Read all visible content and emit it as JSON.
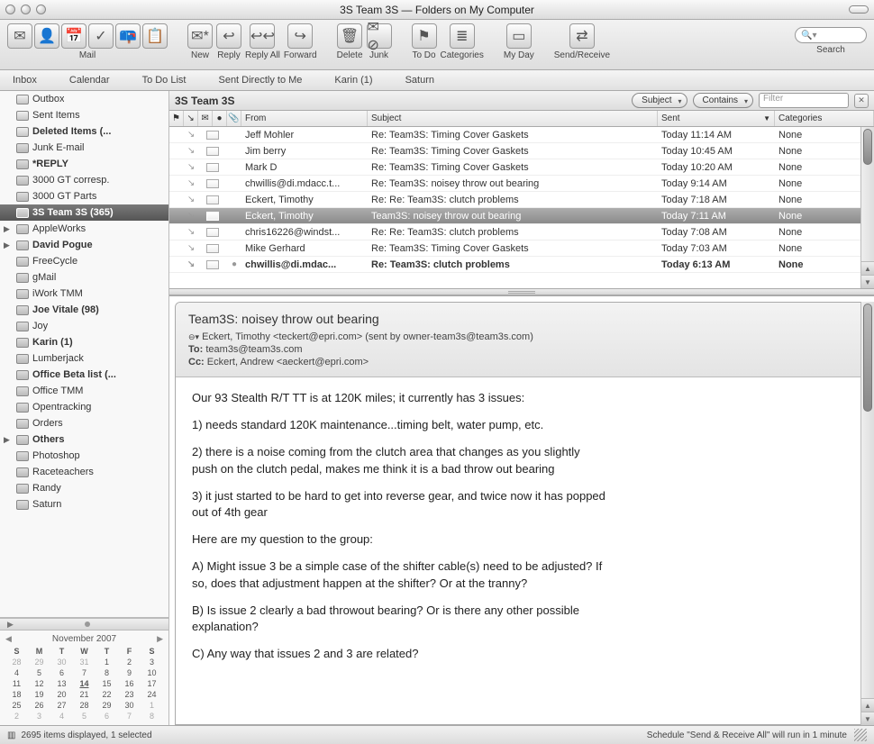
{
  "window": {
    "title": "3S Team 3S — Folders on My Computer"
  },
  "toolbar": {
    "groups": [
      {
        "label": "Mail",
        "icons": [
          "✉",
          "👤",
          "📅",
          "✓",
          "📪",
          "📋"
        ]
      },
      {
        "label": "New",
        "icons": [
          "✉*"
        ]
      },
      {
        "label": "Reply",
        "icons": [
          "↩"
        ]
      },
      {
        "label": "Reply All",
        "icons": [
          "↩↩"
        ]
      },
      {
        "label": "Forward",
        "icons": [
          "↪"
        ]
      },
      {
        "label": "Delete",
        "icons": [
          "🗑"
        ]
      },
      {
        "label": "Junk",
        "icons": [
          "✉⊘"
        ]
      },
      {
        "label": "To Do",
        "icons": [
          "⚑"
        ]
      },
      {
        "label": "Categories",
        "icons": [
          "≣"
        ]
      },
      {
        "label": "My Day",
        "icons": [
          "▭"
        ]
      },
      {
        "label": "Send/Receive",
        "icons": [
          "⇄"
        ]
      },
      {
        "label": "Search",
        "icons": []
      }
    ],
    "search_placeholder": "🔍"
  },
  "tabs": [
    "Inbox",
    "Calendar",
    "To Do List",
    "Sent Directly to Me",
    "Karin (1)",
    "Saturn"
  ],
  "folders": [
    {
      "name": "Outbox",
      "bold": false,
      "special": true
    },
    {
      "name": "Sent Items",
      "bold": false,
      "special": true
    },
    {
      "name": "Deleted Items (...",
      "bold": true,
      "special": true
    },
    {
      "name": "Junk E-mail",
      "bold": false
    },
    {
      "name": "*REPLY",
      "bold": true
    },
    {
      "name": "3000 GT corresp.",
      "bold": false
    },
    {
      "name": "3000 GT Parts",
      "bold": false
    },
    {
      "name": "3S Team 3S (365)",
      "bold": true,
      "selected": true
    },
    {
      "name": "AppleWorks",
      "bold": false,
      "tri": true
    },
    {
      "name": "David Pogue",
      "bold": true,
      "tri": true
    },
    {
      "name": "FreeCycle",
      "bold": false
    },
    {
      "name": "gMail",
      "bold": false
    },
    {
      "name": "iWork TMM",
      "bold": false
    },
    {
      "name": "Joe Vitale (98)",
      "bold": true
    },
    {
      "name": "Joy",
      "bold": false
    },
    {
      "name": "Karin (1)",
      "bold": true
    },
    {
      "name": "Lumberjack",
      "bold": false
    },
    {
      "name": "Office Beta list (...",
      "bold": true
    },
    {
      "name": "Office TMM",
      "bold": false
    },
    {
      "name": "Opentracking",
      "bold": false
    },
    {
      "name": "Orders",
      "bold": false
    },
    {
      "name": "Others",
      "bold": true,
      "tri": true
    },
    {
      "name": "Photoshop",
      "bold": false
    },
    {
      "name": "Raceteachers",
      "bold": false
    },
    {
      "name": "Randy",
      "bold": false
    },
    {
      "name": "Saturn",
      "bold": false
    }
  ],
  "calendar": {
    "title": "November 2007",
    "dow": [
      "S",
      "M",
      "T",
      "W",
      "T",
      "F",
      "S"
    ],
    "rows": [
      [
        "28",
        "29",
        "30",
        "31",
        "1",
        "2",
        "3"
      ],
      [
        "4",
        "5",
        "6",
        "7",
        "8",
        "9",
        "10"
      ],
      [
        "11",
        "12",
        "13",
        "14",
        "15",
        "16",
        "17"
      ],
      [
        "18",
        "19",
        "20",
        "21",
        "22",
        "23",
        "24"
      ],
      [
        "25",
        "26",
        "27",
        "28",
        "29",
        "30",
        "1"
      ],
      [
        "2",
        "3",
        "4",
        "5",
        "6",
        "7",
        "8"
      ]
    ],
    "today": "14",
    "dim_before": 4,
    "dim_after_row": 4
  },
  "listheader": {
    "crumb": "3S Team 3S",
    "subject_label": "Subject",
    "contains_label": "Contains",
    "filter_placeholder": "Filter"
  },
  "columns": {
    "from": "From",
    "subject": "Subject",
    "sent": "Sent",
    "categories": "Categories"
  },
  "messages": [
    {
      "from": "Jeff Mohler",
      "subject": "Re: Team3S: Timing Cover Gaskets",
      "sent": "Today 11:14 AM",
      "cat": "None"
    },
    {
      "from": "Jim berry",
      "subject": "Re: Team3S: Timing Cover Gaskets",
      "sent": "Today 10:45 AM",
      "cat": "None"
    },
    {
      "from": "Mark D",
      "subject": "Re: Team3S: Timing Cover Gaskets",
      "sent": "Today 10:20 AM",
      "cat": "None"
    },
    {
      "from": "chwillis@di.mdacc.t...",
      "subject": "Re: Team3S: noisey throw out bearing",
      "sent": "Today 9:14 AM",
      "cat": "None"
    },
    {
      "from": "Eckert, Timothy",
      "subject": "Re: Re: Team3S: clutch problems",
      "sent": "Today 7:18 AM",
      "cat": "None"
    },
    {
      "from": "Eckert, Timothy",
      "subject": "Team3S: noisey throw out bearing",
      "sent": "Today 7:11 AM",
      "cat": "None",
      "selected": true
    },
    {
      "from": "chris16226@windst...",
      "subject": "Re: Re: Team3S: clutch problems",
      "sent": "Today 7:08 AM",
      "cat": "None"
    },
    {
      "from": "Mike Gerhard",
      "subject": "Re: Team3S: Timing Cover Gaskets",
      "sent": "Today 7:03 AM",
      "cat": "None"
    },
    {
      "from": "chwillis@di.mdac...",
      "subject": "Re: Team3S: clutch problems",
      "sent": "Today 6:13 AM",
      "cat": "None",
      "bold": true,
      "unread": true
    }
  ],
  "preview": {
    "subject": "Team3S: noisey throw out bearing",
    "from": "Eckert, Timothy <teckert@epri.com> (sent by owner-team3s@team3s.com)",
    "to_label": "To:",
    "to": "team3s@team3s.com",
    "cc_label": "Cc:",
    "cc": "Eckert, Andrew <aeckert@epri.com>",
    "body": [
      "Our 93 Stealth R/T TT is at 120K miles; it currently has 3 issues:",
      "1)  needs standard 120K maintenance...timing belt, water pump, etc.",
      "2)  there is a noise coming from the clutch area that changes as you slightly push on the clutch pedal, makes me think it is a bad throw out bearing",
      "3)  it just started to be hard to get into reverse gear,  and twice now it has popped out of 4th gear",
      "Here are my question to the group:",
      "A) Might issue 3 be a simple case of the shifter cable(s) need to be adjusted?  If so, does that adjustment happen at the shifter?  Or at the tranny?",
      "B) Is issue 2 clearly a bad throwout bearing? Or is there any other possible explanation?",
      "C) Any way that issues 2 and 3 are related?"
    ]
  },
  "status": {
    "left": "2695 items displayed, 1 selected",
    "right": "Schedule \"Send & Receive All\" will run in 1 minute"
  }
}
